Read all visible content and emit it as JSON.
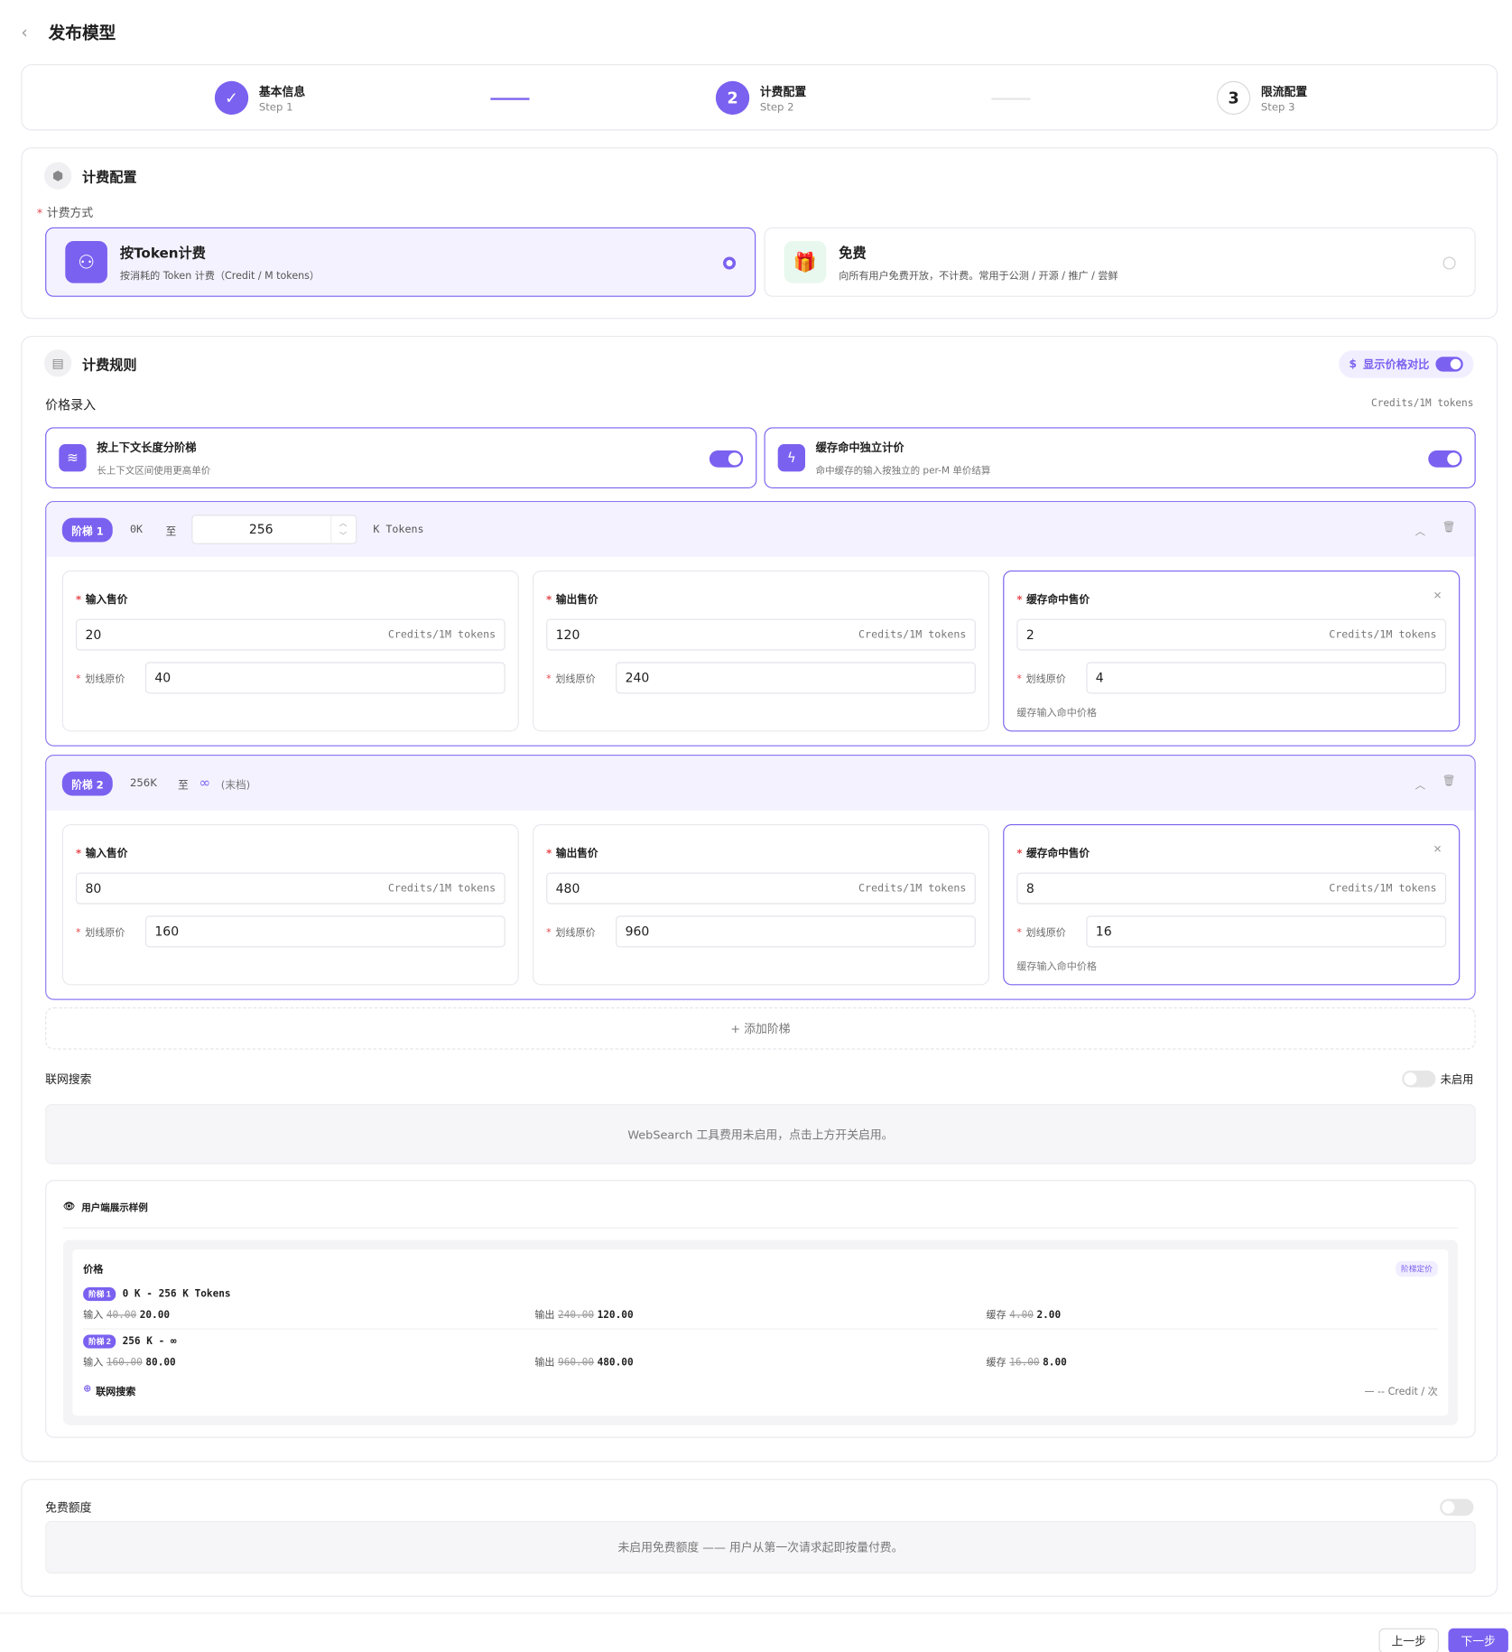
{
  "header": {
    "back_icon": "chevron-left-icon",
    "title": "发布模型"
  },
  "steps": [
    {
      "state": "done",
      "number": "",
      "title": "基本信息",
      "sub": "Step 1"
    },
    {
      "state": "current",
      "number": "2",
      "title": "计费配置",
      "sub": "Step 2"
    },
    {
      "state": "todo",
      "number": "3",
      "title": "限流配置",
      "sub": "Step 3"
    }
  ],
  "billing": {
    "title": "计费配置",
    "method_label": "计费方式",
    "options": [
      {
        "title": "按Token计费",
        "desc": "按消耗的 Token 计费（Credit / M tokens）",
        "selected": true
      },
      {
        "title": "免费",
        "desc": "向所有用户免费开放，不计费。常用于公测 / 开源 / 推广 / 尝鲜",
        "selected": false
      }
    ]
  },
  "rules": {
    "title": "计费规则",
    "compare_label": "显示价格对比",
    "compare_on": true,
    "price_entry": "价格录入",
    "unit": "Credits/1M tokens",
    "features": [
      {
        "title": "按上下文长度分阶梯",
        "desc": "长上下文区间使用更高单价",
        "on": true
      },
      {
        "title": "缓存命中独立计价",
        "desc": "命中缓存的输入按独立的 per-M 单价结算",
        "on": true
      }
    ],
    "tiers": [
      {
        "badge": "阶梯 1",
        "start": "0K",
        "to": "至",
        "end": "256",
        "end_unit": "K Tokens",
        "input": "20",
        "input_orig": "40",
        "output": "120",
        "output_orig": "240",
        "cache": "2",
        "cache_orig": "4"
      },
      {
        "badge": "阶梯 2",
        "start": "256K",
        "to": "至",
        "end_note": "(末档)",
        "input": "80",
        "input_orig": "160",
        "output": "480",
        "output_orig": "960",
        "cache": "8",
        "cache_orig": "16"
      }
    ],
    "labels": {
      "input": "输入售价",
      "output": "输出售价",
      "cache": "缓存命中售价",
      "orig": "划线原价",
      "cache_note": "缓存输入命中价格",
      "unit": "Credits/1M tokens"
    },
    "add_tier": "+ 添加阶梯",
    "websearch": {
      "title": "联网搜索",
      "status": "未启用",
      "on": false,
      "empty": "WebSearch 工具费用未启用，点击上方开关启用。"
    },
    "preview": {
      "title": "用户端展示样例",
      "price": "价格",
      "tag": "阶梯定价",
      "rows": [
        {
          "badge": "阶梯 1",
          "range": "0 K - 256 K Tokens",
          "in_l": "输入",
          "in_o": "40.00",
          "in_v": "20.00",
          "out_l": "输出",
          "out_o": "240.00",
          "out_v": "120.00",
          "c_l": "缓存",
          "c_o": "4.00",
          "c_v": "2.00"
        },
        {
          "badge": "阶梯 2",
          "range": "256 K - ∞",
          "in_l": "输入",
          "in_o": "160.00",
          "in_v": "80.00",
          "out_l": "输出",
          "out_o": "960.00",
          "out_v": "480.00",
          "c_l": "缓存",
          "c_o": "16.00",
          "c_v": "8.00"
        }
      ],
      "ws_label": "联网搜索",
      "ws_value": "— -- Credit / 次"
    }
  },
  "free_quota": {
    "title": "免费额度",
    "on": false,
    "empty": "未启用免费额度 —— 用户从第一次请求起即按量付费。"
  },
  "footer": {
    "prev": "上一步",
    "next": "下一步"
  },
  "colors": {
    "accent": "#7b61f0",
    "free_icon": "#22c55e"
  }
}
